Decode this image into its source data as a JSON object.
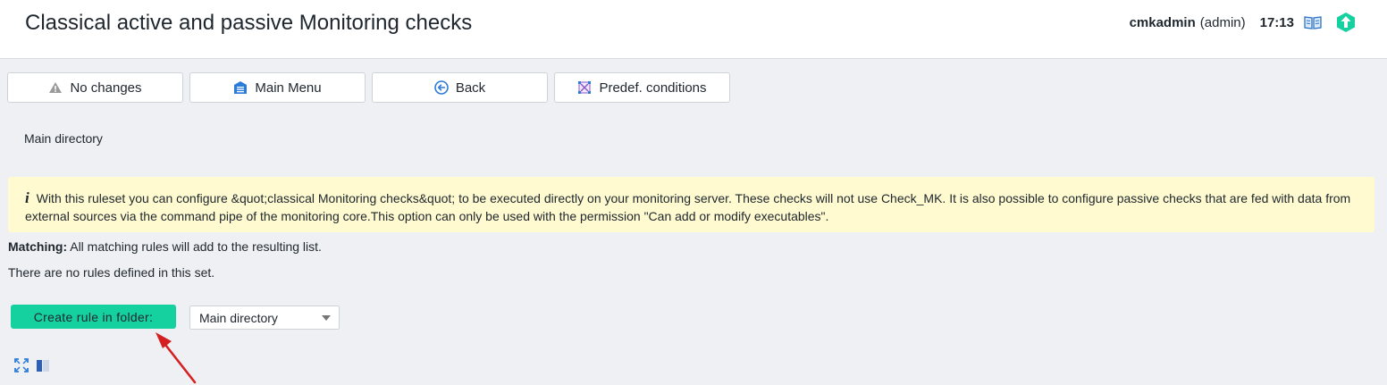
{
  "header": {
    "title": "Classical active and passive Monitoring checks",
    "username": "cmkadmin",
    "role": "(admin)",
    "time": "17:13",
    "icons": {
      "help": "book-icon",
      "logo": "checkmk-logo-icon"
    }
  },
  "toolbar": {
    "buttons": [
      {
        "label": "No changes",
        "icon": "warning-icon"
      },
      {
        "label": "Main Menu",
        "icon": "main-menu-icon"
      },
      {
        "label": "Back",
        "icon": "back-icon"
      },
      {
        "label": "Predef. conditions",
        "icon": "predefined-conditions-icon"
      }
    ]
  },
  "breadcrumb": "Main directory",
  "info": {
    "icon": "i",
    "text": "With this ruleset you can configure &quot;classical Monitoring checks&quot; to be executed directly on your monitoring server. These checks will not use Check_MK. It is also possible to configure passive checks that are fed with data from external sources via the command pipe of the monitoring core.This option can only be used with the permission \"Can add or modify executables\"."
  },
  "matching": {
    "label": "Matching:",
    "text": "All matching rules will add to the resulting list."
  },
  "no_rules": "There are no rules defined in this set.",
  "create": {
    "button_label": "Create rule in folder:",
    "folder_value": "Main directory"
  },
  "footer_icons": [
    "fullscreen-icon",
    "column-toggle-icon"
  ],
  "colors": {
    "accent": "#15d1a0",
    "info_bg": "#fffacf",
    "page_bg": "#eff0f3",
    "annotation_arrow": "#d42020"
  }
}
